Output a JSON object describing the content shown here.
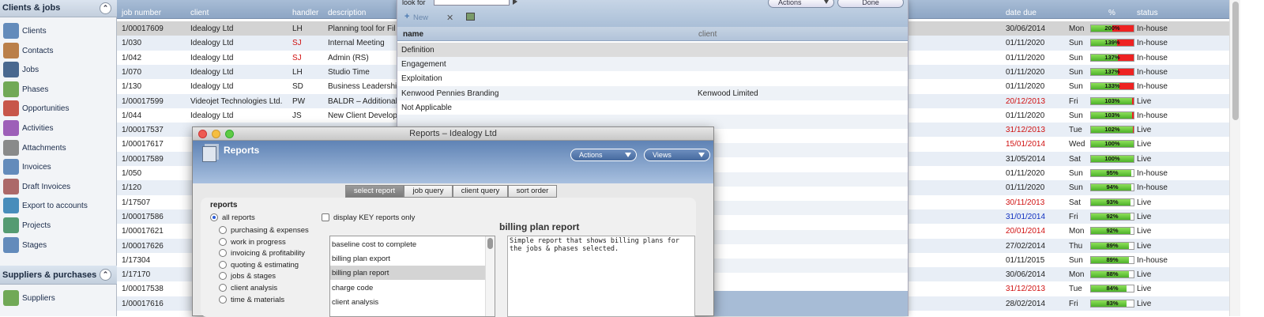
{
  "sidebar": {
    "section1_title": "Clients & jobs",
    "section2_title": "Suppliers & purchases",
    "items": [
      {
        "label": "Clients",
        "icon": "clients-icon"
      },
      {
        "label": "Contacts",
        "icon": "contacts-icon"
      },
      {
        "label": "Jobs",
        "icon": "jobs-icon"
      },
      {
        "label": "Phases",
        "icon": "phases-icon"
      },
      {
        "label": "Opportunities",
        "icon": "opportunities-icon"
      },
      {
        "label": "Activities",
        "icon": "activities-icon"
      },
      {
        "label": "Attachments",
        "icon": "attachments-icon"
      },
      {
        "label": "Invoices",
        "icon": "invoices-icon"
      },
      {
        "label": "Draft Invoices",
        "icon": "draft-invoices-icon"
      },
      {
        "label": "Export to accounts",
        "icon": "export-icon"
      },
      {
        "label": "Projects",
        "icon": "projects-icon"
      },
      {
        "label": "Stages",
        "icon": "stages-icon"
      }
    ],
    "items2": [
      {
        "label": "Suppliers",
        "icon": "suppliers-icon"
      }
    ]
  },
  "grid": {
    "headers": {
      "job_number": "job number",
      "client": "client",
      "handler": "handler",
      "description": "description",
      "date_due": "date due",
      "percent": "%",
      "status": "status"
    },
    "rows": [
      {
        "job": "1/00017609",
        "client": "Idealogy Ltd",
        "handler": "LH",
        "desc": "Planning tool for Fil",
        "date": "30/06/2014",
        "day": "Mon",
        "pct": 200,
        "pct_label": "200%",
        "status": "In-house",
        "handler_red": false,
        "date_color": "#222"
      },
      {
        "job": "1/030",
        "client": "Idealogy Ltd",
        "handler": "SJ",
        "desc": "Internal Meeting",
        "date": "01/11/2020",
        "day": "Sun",
        "pct": 139,
        "pct_label": "139%",
        "status": "In-house",
        "handler_red": true,
        "date_color": "#222"
      },
      {
        "job": "1/042",
        "client": "Idealogy Ltd",
        "handler": "SJ",
        "desc": "Admin (RS)",
        "date": "01/11/2020",
        "day": "Sun",
        "pct": 137,
        "pct_label": "137%",
        "status": "In-house",
        "handler_red": true,
        "date_color": "#222"
      },
      {
        "job": "1/070",
        "client": "Idealogy Ltd",
        "handler": "LH",
        "desc": "Studio Time",
        "date": "01/11/2020",
        "day": "Sun",
        "pct": 137,
        "pct_label": "137%",
        "status": "In-house",
        "handler_red": false,
        "date_color": "#222"
      },
      {
        "job": "1/130",
        "client": "Idealogy Ltd",
        "handler": "SD",
        "desc": "Business Leadership",
        "date": "01/11/2020",
        "day": "Sun",
        "pct": 133,
        "pct_label": "133%",
        "status": "In-house",
        "handler_red": false,
        "date_color": "#222"
      },
      {
        "job": "1/00017599",
        "client": "Videojet Technologies Ltd.",
        "handler": "PW",
        "desc": "BALDR – Additional",
        "date": "20/12/2013",
        "day": "Fri",
        "pct": 103,
        "pct_label": "103%",
        "status": "Live",
        "handler_red": false,
        "date_color": "#d01010"
      },
      {
        "job": "1/044",
        "client": "Idealogy Ltd",
        "handler": "JS",
        "desc": "New Client Develop",
        "date": "01/11/2020",
        "day": "Sun",
        "pct": 103,
        "pct_label": "103%",
        "status": "In-house",
        "handler_red": false,
        "date_color": "#222"
      },
      {
        "job": "1/00017537",
        "client": "",
        "handler": "",
        "desc": "",
        "date": "31/12/2013",
        "day": "Tue",
        "pct": 102,
        "pct_label": "102%",
        "status": "Live",
        "handler_red": false,
        "date_color": "#d01010"
      },
      {
        "job": "1/00017617",
        "client": "",
        "handler": "",
        "desc": "",
        "date": "15/01/2014",
        "day": "Wed",
        "pct": 100,
        "pct_label": "100%",
        "status": "Live",
        "handler_red": false,
        "date_color": "#d01010"
      },
      {
        "job": "1/00017589",
        "client": "",
        "handler": "",
        "desc": "",
        "date": "31/05/2014",
        "day": "Sat",
        "pct": 100,
        "pct_label": "100%",
        "status": "Live",
        "handler_red": false,
        "date_color": "#222"
      },
      {
        "job": "1/050",
        "client": "",
        "handler": "",
        "desc": "",
        "date": "01/11/2020",
        "day": "Sun",
        "pct": 95,
        "pct_label": "95%",
        "status": "In-house",
        "handler_red": false,
        "date_color": "#222"
      },
      {
        "job": "1/120",
        "client": "",
        "handler": "",
        "desc": "",
        "date": "01/11/2020",
        "day": "Sun",
        "pct": 94,
        "pct_label": "94%",
        "status": "In-house",
        "handler_red": false,
        "date_color": "#222"
      },
      {
        "job": "1/17507",
        "client": "",
        "handler": "",
        "desc": "",
        "date": "30/11/2013",
        "day": "Sat",
        "pct": 93,
        "pct_label": "93%",
        "status": "Live",
        "handler_red": false,
        "date_color": "#d01010"
      },
      {
        "job": "1/00017586",
        "client": "",
        "handler": "",
        "desc": "",
        "date": "31/01/2014",
        "day": "Fri",
        "pct": 92,
        "pct_label": "92%",
        "status": "Live",
        "handler_red": false,
        "date_color": "#1030c0"
      },
      {
        "job": "1/00017621",
        "client": "",
        "handler": "",
        "desc": "",
        "date": "20/01/2014",
        "day": "Mon",
        "pct": 92,
        "pct_label": "92%",
        "status": "Live",
        "handler_red": false,
        "date_color": "#d01010"
      },
      {
        "job": "1/00017626",
        "client": "",
        "handler": "",
        "desc": "",
        "date": "27/02/2014",
        "day": "Thu",
        "pct": 89,
        "pct_label": "89%",
        "status": "Live",
        "handler_red": false,
        "date_color": "#222"
      },
      {
        "job": "1/17304",
        "client": "",
        "handler": "",
        "desc": "",
        "date": "01/11/2015",
        "day": "Sun",
        "pct": 89,
        "pct_label": "89%",
        "status": "In-house",
        "handler_red": false,
        "date_color": "#222"
      },
      {
        "job": "1/17170",
        "client": "",
        "handler": "",
        "desc": "",
        "date": "30/06/2014",
        "day": "Mon",
        "pct": 88,
        "pct_label": "88%",
        "status": "Live",
        "handler_red": false,
        "date_color": "#222"
      },
      {
        "job": "1/00017538",
        "client": "",
        "handler": "",
        "desc": "",
        "date": "31/12/2013",
        "day": "Tue",
        "pct": 84,
        "pct_label": "84%",
        "status": "Live",
        "handler_red": false,
        "date_color": "#d01010"
      },
      {
        "job": "1/00017616",
        "client": "",
        "handler": "",
        "desc": "",
        "date": "28/02/2014",
        "day": "Fri",
        "pct": 83,
        "pct_label": "83%",
        "status": "Live",
        "handler_red": false,
        "date_color": "#222"
      }
    ]
  },
  "lookup": {
    "look_for_label": "look for",
    "search_value": "",
    "new_label": "New",
    "actions_label": "Actions",
    "done_label": "Done",
    "col_name": "name",
    "col_client": "client",
    "rows": [
      {
        "name": "Definition",
        "client": ""
      },
      {
        "name": "Engagement",
        "client": ""
      },
      {
        "name": "Exploitation",
        "client": ""
      },
      {
        "name": "Kenwood Pennies Branding",
        "client": "Kenwood Limited"
      },
      {
        "name": "Not Applicable",
        "client": ""
      }
    ]
  },
  "reports": {
    "window_title": "Reports – Idealogy Ltd",
    "banner_title": "Reports",
    "actions_label": "Actions",
    "views_label": "Views",
    "tabs": [
      "select report",
      "job query",
      "client query",
      "sort order"
    ],
    "active_tab": 0,
    "reports_label": "reports",
    "categories": [
      "all reports",
      "purchasing & expenses",
      "work in progress",
      "invoicing & profitability",
      "quoting & estimating",
      "jobs & stages",
      "client analysis",
      "time & materials"
    ],
    "selected_category": 0,
    "key_only_label": "display KEY reports only",
    "report_list": [
      "baseline cost to complete",
      "billing plan export",
      "billing plan report",
      "charge code",
      "client analysis"
    ],
    "selected_report": 2,
    "selected_report_title": "billing plan report",
    "selected_report_description": "Simple report that shows billing plans for the jobs & phases selected."
  },
  "colors": {
    "header_blue": "#8da6c4",
    "row_alt": "#e8eef6",
    "row_selected": "#d3d3d3",
    "late_red": "#d01010",
    "future_blue": "#1030c0"
  }
}
